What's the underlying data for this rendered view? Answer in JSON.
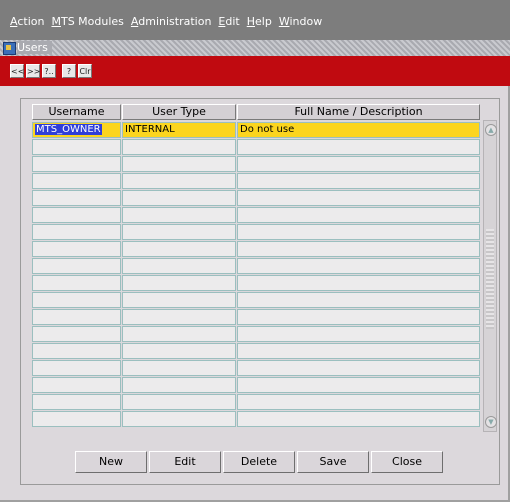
{
  "menu": [
    {
      "key": "A",
      "rest": "ction"
    },
    {
      "key": "M",
      "rest": "TS Modules"
    },
    {
      "key": "A",
      "rest": "dministration"
    },
    {
      "key": "E",
      "rest": "dit"
    },
    {
      "key": "H",
      "rest": "elp"
    },
    {
      "key": "W",
      "rest": "indow"
    }
  ],
  "window": {
    "title": "Users"
  },
  "toolbar": [
    "<<",
    ">>",
    "?..",
    "?",
    "Clr"
  ],
  "table": {
    "headers": [
      "Username",
      "User Type",
      "Full Name / Description"
    ],
    "rows": [
      [
        "MTS_OWNER",
        "INTERNAL",
        "Do not use"
      ],
      [
        "",
        "",
        ""
      ],
      [
        "",
        "",
        ""
      ],
      [
        "",
        "",
        ""
      ],
      [
        "",
        "",
        ""
      ],
      [
        "",
        "",
        ""
      ],
      [
        "",
        "",
        ""
      ],
      [
        "",
        "",
        ""
      ],
      [
        "",
        "",
        ""
      ],
      [
        "",
        "",
        ""
      ],
      [
        "",
        "",
        ""
      ],
      [
        "",
        "",
        ""
      ],
      [
        "",
        "",
        ""
      ],
      [
        "",
        "",
        ""
      ],
      [
        "",
        "",
        ""
      ],
      [
        "",
        "",
        ""
      ],
      [
        "",
        "",
        ""
      ],
      [
        "",
        "",
        ""
      ]
    ]
  },
  "buttons": {
    "new": "New",
    "edit": "Edit",
    "delete": "Delete",
    "save": "Save",
    "close": "Close"
  }
}
